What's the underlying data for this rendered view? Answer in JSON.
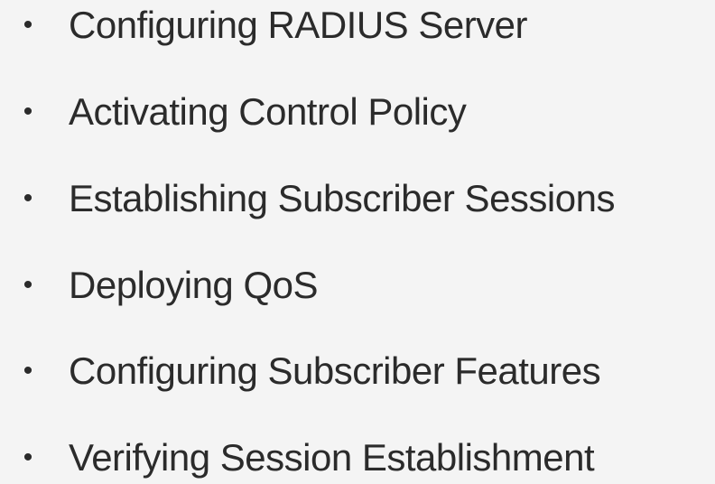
{
  "bullet_symbol": "•",
  "text_color": "#2b2b2b",
  "background_color": "#f4f4f4",
  "items": [
    {
      "label": "Configuring RADIUS Server"
    },
    {
      "label": "Activating Control Policy"
    },
    {
      "label": "Establishing Subscriber Sessions"
    },
    {
      "label": "Deploying QoS"
    },
    {
      "label": "Configuring Subscriber Features"
    },
    {
      "label": "Verifying Session Establishment"
    }
  ]
}
